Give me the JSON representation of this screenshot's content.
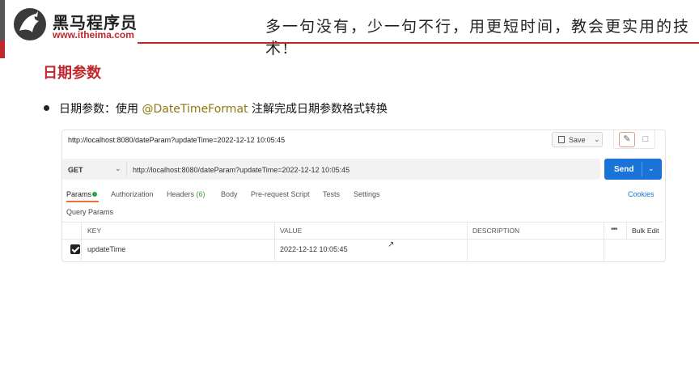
{
  "header": {
    "logo_cn": "黑马程序员",
    "logo_url": "www.itheima.com",
    "slogan": "多一句没有，少一句不行，用更短时间，教会更实用的技术!"
  },
  "slide": {
    "section_title": "日期参数",
    "bullet_prefix": "日期参数：使用 ",
    "bullet_highlight": "@DateTimeFormat",
    "bullet_suffix": " 注解完成日期参数格式转换"
  },
  "postman": {
    "request_title": "http://localhost:8080/dateParam?updateTime=2022-12-12 10:05:45",
    "save_label": "Save",
    "method": "GET",
    "url": "http://localhost:8080/dateParam?updateTime=2022-12-12 10:05:45",
    "send_label": "Send",
    "tabs": {
      "params": "Params",
      "authorization": "Authorization",
      "headers": "Headers",
      "headers_count": "(6)",
      "body": "Body",
      "prerequest": "Pre-request Script",
      "tests": "Tests",
      "settings": "Settings"
    },
    "cookies_label": "Cookies",
    "query_params_label": "Query Params",
    "columns": {
      "key": "KEY",
      "value": "VALUE",
      "description": "DESCRIPTION",
      "more": "•••",
      "bulk_edit": "Bulk Edit"
    },
    "rows": [
      {
        "checked": true,
        "key": "updateTime",
        "value": "2022-12-12 10:05:45",
        "description": ""
      }
    ]
  },
  "colors": {
    "brand_red": "#c0272d",
    "send_blue": "#1a73d9",
    "tab_active_underline": "#f26b3a",
    "highlight_text": "#8a7a10"
  }
}
